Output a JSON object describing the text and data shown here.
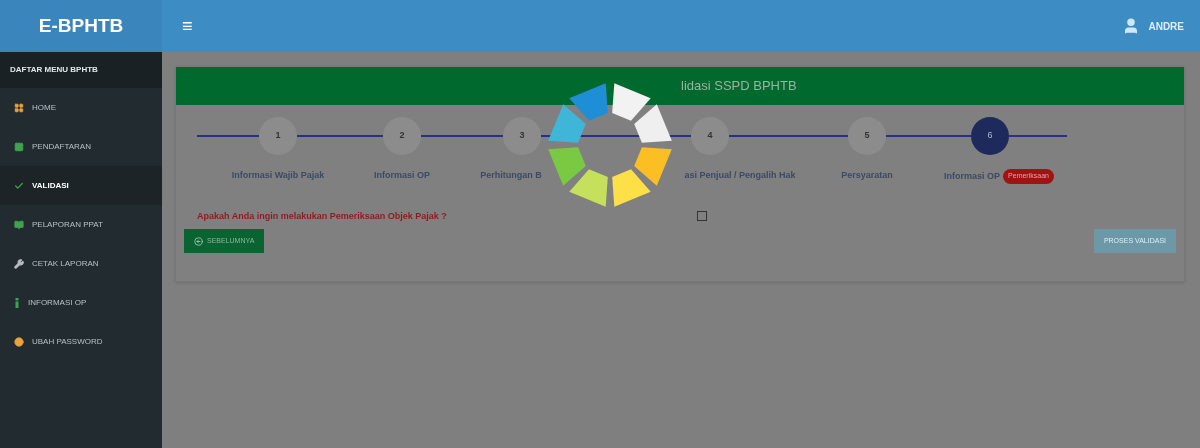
{
  "header": {
    "logo": "E-BPHTB",
    "menu_glyph": "≡",
    "user": "ANDRE"
  },
  "sidebar": {
    "heading": "DAFTAR MENU BPHTB",
    "items": [
      {
        "label": "HOME",
        "selected": false,
        "kind": "grid",
        "color": "#e8a33a"
      },
      {
        "label": "PENDAFTARAN",
        "selected": false,
        "kind": "table",
        "color": "#3fa34d"
      },
      {
        "label": "VALIDASI",
        "selected": true,
        "kind": "check",
        "color": "#3fa34d"
      },
      {
        "label": "PELAPORAN PPAT",
        "selected": false,
        "kind": "book",
        "color": "#3fa34d"
      },
      {
        "label": "CETAK LAPORAN",
        "selected": false,
        "kind": "wrench",
        "color": "#b8bcc0"
      },
      {
        "label": "INFORMASI OP",
        "selected": false,
        "kind": "info",
        "color": "#3fa34d"
      },
      {
        "label": "UBAH PASSWORD",
        "selected": false,
        "kind": "dot",
        "color": "#e8a33a"
      }
    ]
  },
  "panel": {
    "title": "lidasi SSPD BPHTB",
    "steps": [
      {
        "number": "1",
        "label": "Informasi Wajib Pajak",
        "selected": false
      },
      {
        "number": "2",
        "label": "Informasi OP",
        "selected": false
      },
      {
        "number": "3",
        "label": "Perhitungan B",
        "selected": false
      },
      {
        "number": "4",
        "label": "asi Penjual / Pengalih Hak",
        "selected": false
      },
      {
        "number": "5",
        "label": "Persyaratan",
        "selected": false
      },
      {
        "number": "6",
        "label": "Informasi OP",
        "badge": "Pemeriksaan",
        "selected": true
      }
    ],
    "question": "Apakah Anda ingin melakukan Pemeriksaan Objek Pajak ?",
    "question_checked": false,
    "prev_button": "SEBELUMNYA",
    "next_button": "PROSES VALIDASI"
  },
  "loading": true
}
